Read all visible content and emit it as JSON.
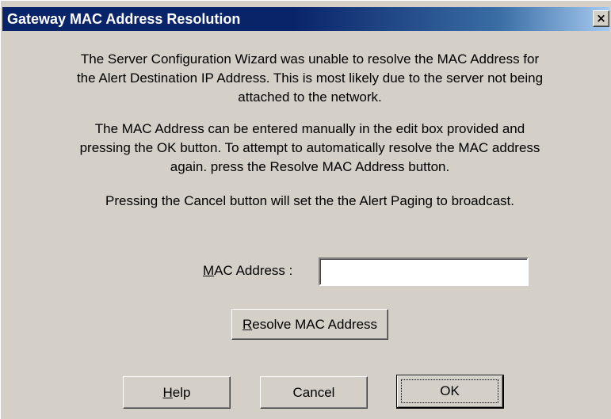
{
  "window": {
    "title": "Gateway MAC Address Resolution",
    "close_glyph": "×"
  },
  "message": {
    "paragraph_1": "The Server Configuration Wizard was unable to resolve the MAC Address for the Alert Destination IP Address.  This is most likely due to the server not being attached to the network.",
    "paragraph_2": "The MAC Address can be entered manually in the edit box provided and pressing the OK button.  To attempt to automatically resolve the MAC address again. press the Resolve MAC Address button.",
    "paragraph_3": "Pressing the Cancel button will set the the Alert Paging to broadcast."
  },
  "mac_field": {
    "label_mnemonic": "M",
    "label_rest": "AC Address :",
    "value": ""
  },
  "buttons": {
    "resolve_mnemonic": "R",
    "resolve_rest": "esolve MAC Address",
    "help_mnemonic": "H",
    "help_rest": "elp",
    "cancel": "Cancel",
    "ok": "OK"
  },
  "icons": {
    "close": "close-icon"
  }
}
